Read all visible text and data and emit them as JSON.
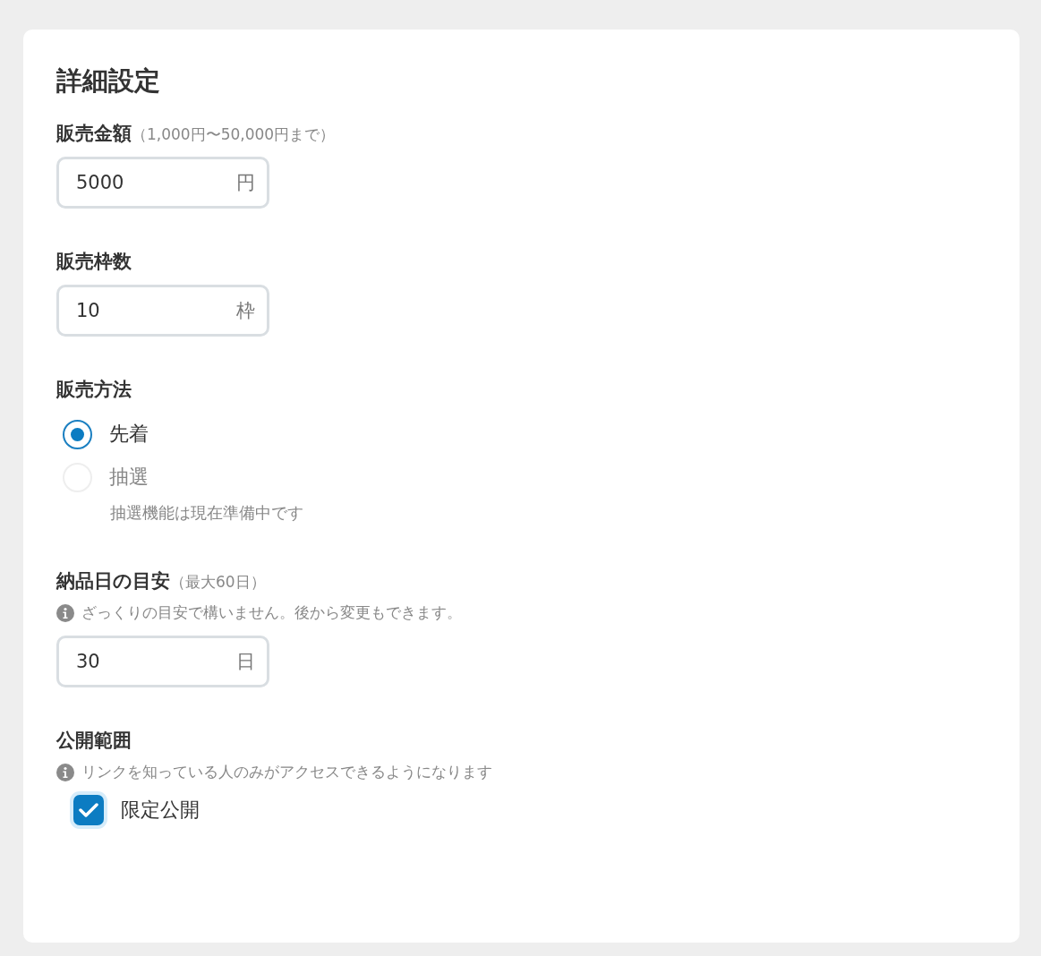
{
  "title": "詳細設定",
  "sections": [
    {
      "kind": "number",
      "label": "販売金額",
      "hint": "（1,000円〜50,000円まで）",
      "value": "5000",
      "unit": "円"
    },
    {
      "kind": "number",
      "label": "販売枠数",
      "value": "10",
      "unit": "枠"
    },
    {
      "kind": "radio",
      "label": "販売方法",
      "options": [
        {
          "label": "先着",
          "selected": true,
          "disabled": false
        },
        {
          "label": "抽選",
          "selected": false,
          "disabled": true,
          "note": "抽選機能は現在準備中です"
        }
      ]
    },
    {
      "kind": "number",
      "label": "納品日の目安",
      "hint": "（最大60日）",
      "info": "ざっくりの目安で構いません。後から変更もできます。",
      "value": "30",
      "unit": "日"
    },
    {
      "kind": "checkbox",
      "label": "公開範囲",
      "info": "リンクを知っている人のみがアクセスできるようになります",
      "option": {
        "label": "限定公開",
        "checked": true
      }
    }
  ]
}
